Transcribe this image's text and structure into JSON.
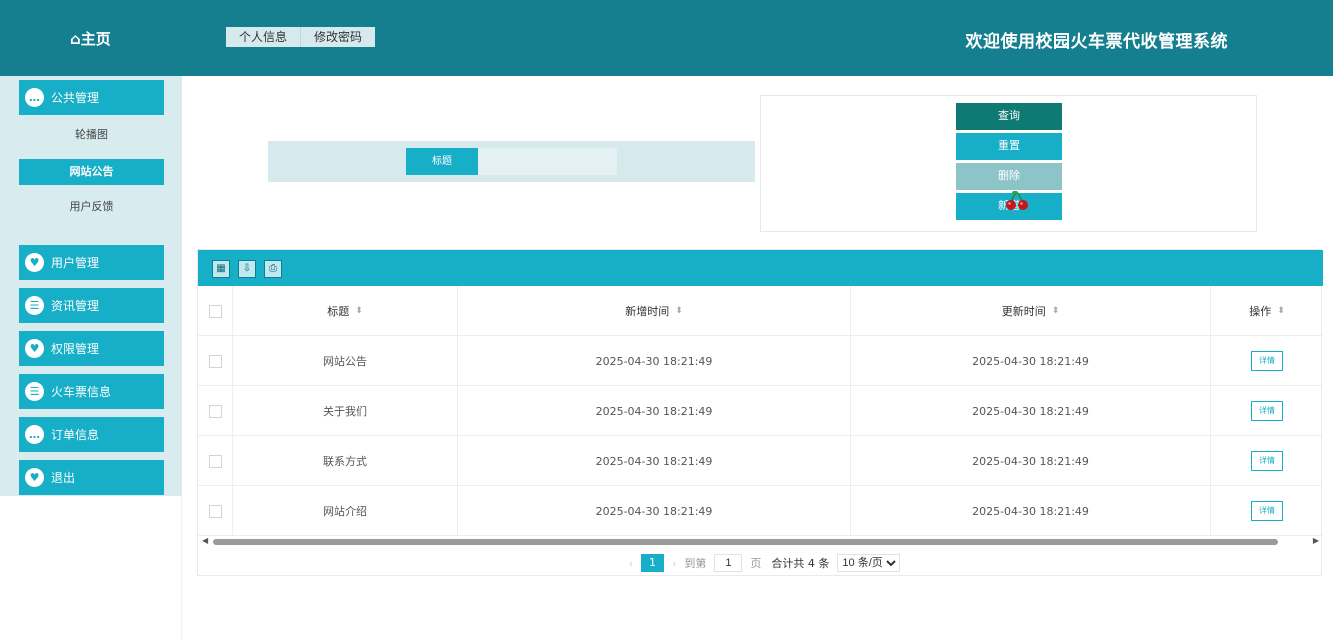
{
  "header": {
    "home_label": "主页",
    "tabs": [
      "个人信息",
      "修改密码"
    ],
    "system_title": "欢迎使用校园火车票代收管理系统"
  },
  "sidebar": {
    "groups": [
      {
        "label": "公共管理",
        "icon": "chat-icon",
        "sub_items": [
          "轮播图",
          "网站公告",
          "用户反馈"
        ],
        "active_sub": "网站公告"
      },
      {
        "label": "用户管理",
        "icon": "heart-icon"
      },
      {
        "label": "资讯管理",
        "icon": "list-icon"
      },
      {
        "label": "权限管理",
        "icon": "heart-icon"
      },
      {
        "label": "火车票信息",
        "icon": "list-icon"
      },
      {
        "label": "订单信息",
        "icon": "chat-icon"
      },
      {
        "label": "退出",
        "icon": "heart-icon"
      }
    ]
  },
  "search": {
    "field_label": "标题",
    "field_value": ""
  },
  "actions": {
    "query": "查询",
    "reset": "重置",
    "delete": "删除",
    "add": "新增"
  },
  "table": {
    "toolbar_icons": [
      "columns-icon",
      "export-icon",
      "print-icon"
    ],
    "columns": [
      "标题",
      "新增时间",
      "更新时间",
      "操作"
    ],
    "rows": [
      {
        "title": "网站公告",
        "created": "2025-04-30 18:21:49",
        "updated": "2025-04-30 18:21:49",
        "action": "详情"
      },
      {
        "title": "关于我们",
        "created": "2025-04-30 18:21:49",
        "updated": "2025-04-30 18:21:49",
        "action": "详情"
      },
      {
        "title": "联系方式",
        "created": "2025-04-30 18:21:49",
        "updated": "2025-04-30 18:21:49",
        "action": "详情"
      },
      {
        "title": "网站介绍",
        "created": "2025-04-30 18:21:49",
        "updated": "2025-04-30 18:21:49",
        "action": "详情"
      }
    ]
  },
  "pagination": {
    "current_page": "1",
    "goto_label": "到第",
    "goto_value": "1",
    "page_suffix": "页",
    "total_text": "合计共 4 条",
    "page_size": "10 条/页"
  },
  "colors": {
    "header_bg": "#167f8f",
    "accent": "#17aec8",
    "query_button": "#0f7a73",
    "delete_button": "#8cc4c8",
    "sidebar_bg": "#d8ecf0"
  }
}
